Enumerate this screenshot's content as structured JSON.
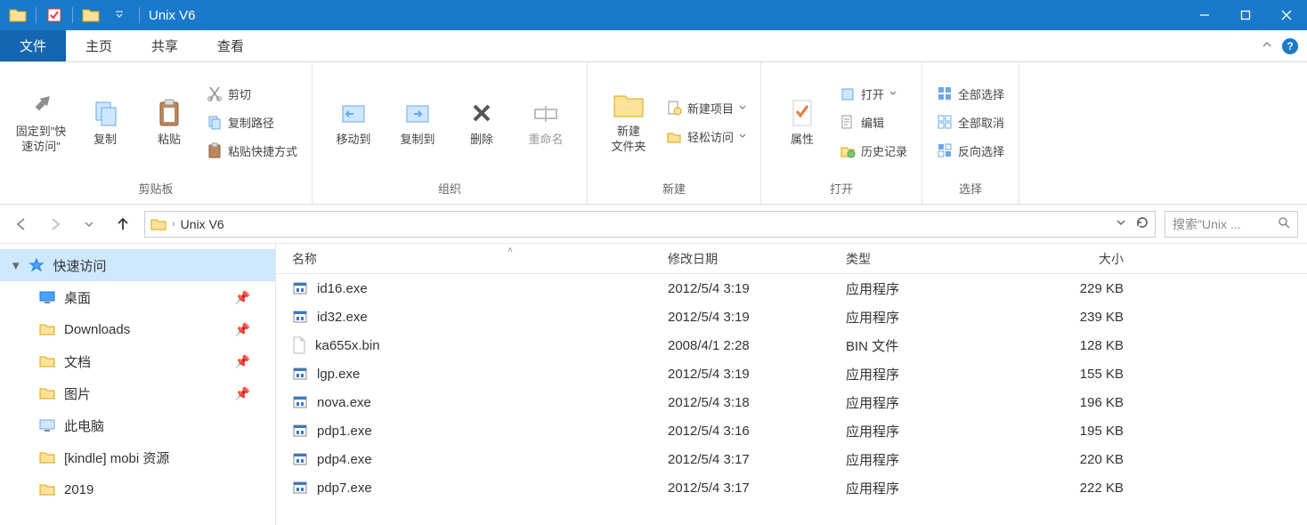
{
  "window": {
    "title": "Unix V6"
  },
  "tabs": {
    "file": "文件",
    "home": "主页",
    "share": "共享",
    "view": "查看"
  },
  "ribbon": {
    "clipboard": {
      "caption": "剪贴板",
      "pin_quick": "固定到\"快\n速访问\"",
      "copy": "复制",
      "paste": "粘贴",
      "cut": "剪切",
      "copy_path": "复制路径",
      "paste_shortcut": "粘贴快捷方式"
    },
    "organize": {
      "caption": "组织",
      "move_to": "移动到",
      "copy_to": "复制到",
      "delete": "删除",
      "rename": "重命名"
    },
    "new": {
      "caption": "新建",
      "new_folder": "新建\n文件夹",
      "new_item": "新建项目",
      "easy_access": "轻松访问"
    },
    "open": {
      "caption": "打开",
      "properties": "属性",
      "open": "打开",
      "edit": "编辑",
      "history": "历史记录"
    },
    "select": {
      "caption": "选择",
      "select_all": "全部选择",
      "select_none": "全部取消",
      "invert": "反向选择"
    }
  },
  "addressbar": {
    "crumb1": "Unix V6"
  },
  "search": {
    "placeholder": "搜索\"Unix ..."
  },
  "navpane": {
    "quick_access": "快速访问",
    "desktop": "桌面",
    "downloads": "Downloads",
    "documents": "文档",
    "pictures": "图片",
    "this_pc": "此电脑",
    "kindle": "[kindle] mobi 资源",
    "y2019": "2019"
  },
  "columns": {
    "name": "名称",
    "date": "修改日期",
    "type": "类型",
    "size": "大小"
  },
  "files": [
    {
      "name": "id16.exe",
      "date": "2012/5/4 3:19",
      "type": "应用程序",
      "size": "229 KB",
      "icon": "exe"
    },
    {
      "name": "id32.exe",
      "date": "2012/5/4 3:19",
      "type": "应用程序",
      "size": "239 KB",
      "icon": "exe"
    },
    {
      "name": "ka655x.bin",
      "date": "2008/4/1 2:28",
      "type": "BIN 文件",
      "size": "128 KB",
      "icon": "bin"
    },
    {
      "name": "lgp.exe",
      "date": "2012/5/4 3:19",
      "type": "应用程序",
      "size": "155 KB",
      "icon": "exe"
    },
    {
      "name": "nova.exe",
      "date": "2012/5/4 3:18",
      "type": "应用程序",
      "size": "196 KB",
      "icon": "exe"
    },
    {
      "name": "pdp1.exe",
      "date": "2012/5/4 3:16",
      "type": "应用程序",
      "size": "195 KB",
      "icon": "exe"
    },
    {
      "name": "pdp4.exe",
      "date": "2012/5/4 3:17",
      "type": "应用程序",
      "size": "220 KB",
      "icon": "exe"
    },
    {
      "name": "pdp7.exe",
      "date": "2012/5/4 3:17",
      "type": "应用程序",
      "size": "222 KB",
      "icon": "exe"
    }
  ]
}
